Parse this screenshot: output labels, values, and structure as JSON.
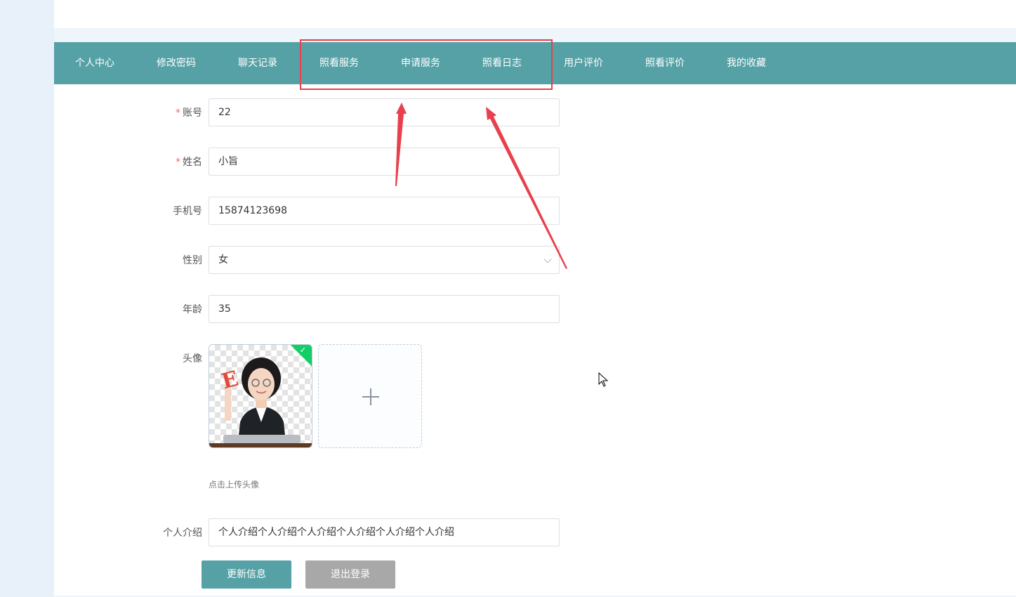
{
  "nav": {
    "items": [
      {
        "label": "个人中心"
      },
      {
        "label": "修改密码"
      },
      {
        "label": "聊天记录"
      },
      {
        "label": "照看服务"
      },
      {
        "label": "申请服务"
      },
      {
        "label": "照看日志"
      },
      {
        "label": "用户评价"
      },
      {
        "label": "照看评价"
      },
      {
        "label": "我的收藏"
      }
    ]
  },
  "form": {
    "account": {
      "label": "账号",
      "value": "22",
      "required": true
    },
    "name": {
      "label": "姓名",
      "value": "小旨",
      "required": true
    },
    "phone": {
      "label": "手机号",
      "value": "15874123698"
    },
    "gender": {
      "label": "性别",
      "value": "女"
    },
    "age": {
      "label": "年龄",
      "value": "35"
    },
    "avatar": {
      "label": "头像",
      "tip": "点击上传头像"
    },
    "intro": {
      "label": "个人介绍",
      "value": "个人介绍个人介绍个人介绍个人介绍个人介绍个人介绍"
    }
  },
  "buttons": {
    "update": "更新信息",
    "logout": "退出登录"
  },
  "required_mark": "*",
  "colors": {
    "accent": "#56a1a6",
    "secondary_button": "#a8a8a8",
    "annotation": "#e8404c",
    "success": "#13ce66"
  }
}
